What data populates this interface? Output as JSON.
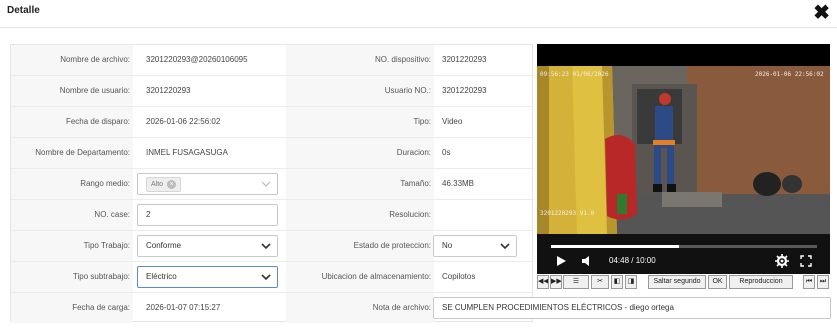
{
  "header": {
    "title": "Detalle",
    "close_icon": "close-x-icon"
  },
  "fields": {
    "nombre_archivo": {
      "label": "Nombre de archivo:",
      "value": "3201220293@20260106095"
    },
    "dispositivo": {
      "label": "NO. dispositivo:",
      "value": "3201220293"
    },
    "nombre_usuario": {
      "label": "Nombre de usuario:",
      "value": "3201220293"
    },
    "usuario_no": {
      "label": "Usuario NO.:",
      "value": "3201220293"
    },
    "fecha_disparo": {
      "label": "Fecha de disparo:",
      "value": "2026-01-06 22:56:02"
    },
    "tipo": {
      "label": "Tipo:",
      "value": "Video"
    },
    "departamento": {
      "label": "Nombre de Departamento:",
      "value": "INMEL FUSAGASUGA"
    },
    "duracion": {
      "label": "Duracion:",
      "value": "0s"
    },
    "rango_medio": {
      "label": "Rango medio:",
      "tag": "Alto"
    },
    "tamano": {
      "label": "Tamaño:",
      "value": "46.33MB"
    },
    "no_case": {
      "label": "NO. case:",
      "value": "2"
    },
    "resolucion": {
      "label": "Resolucion:",
      "value": ""
    },
    "tipo_trabajo": {
      "label": "Tipo Trabajo:",
      "value": "Conforme"
    },
    "estado_proteccion": {
      "label": "Estado de proteccion:",
      "value": "No"
    },
    "tipo_subtrabajo": {
      "label": "Tipo subtrabajo:",
      "value": "Eléctrico"
    },
    "ubicacion": {
      "label": "Ubicacion de almacenamiento:",
      "value": "Copilotos"
    },
    "fecha_carga": {
      "label": "Fecha de carga:",
      "value": "2026-01-07 07:15:27"
    },
    "nota_archivo": {
      "label": "Nota de archivo:",
      "value": "SE CUMPLEN PROCEDIMIENTOS ELÉCTRICOS - diego ortega"
    }
  },
  "player": {
    "time": "04:48 / 10:00",
    "progress": 0.48,
    "osd_top_left": "09:56:23 01/06/2026",
    "osd_top_right": "2026-01-06 22:56:02",
    "osd_bottom_left": "3201220293 V1.0",
    "icons": [
      "play-icon",
      "volume-icon",
      "settings-gear-icon",
      "fullscreen-icon"
    ]
  },
  "toolbar": {
    "saltar_label": "Saltar segundo",
    "ok_label": "OK",
    "reproduccion_label": "Reproduccion",
    "icons": [
      "rewind-icon",
      "fast-forward-icon",
      "list-icon",
      "scissors-icon",
      "frame-back-icon",
      "frame-forward-icon",
      "prev-icon",
      "next-icon"
    ]
  },
  "colors": {
    "accent_border": "#5b8ac9",
    "label_bg": "#f7f7f7"
  }
}
